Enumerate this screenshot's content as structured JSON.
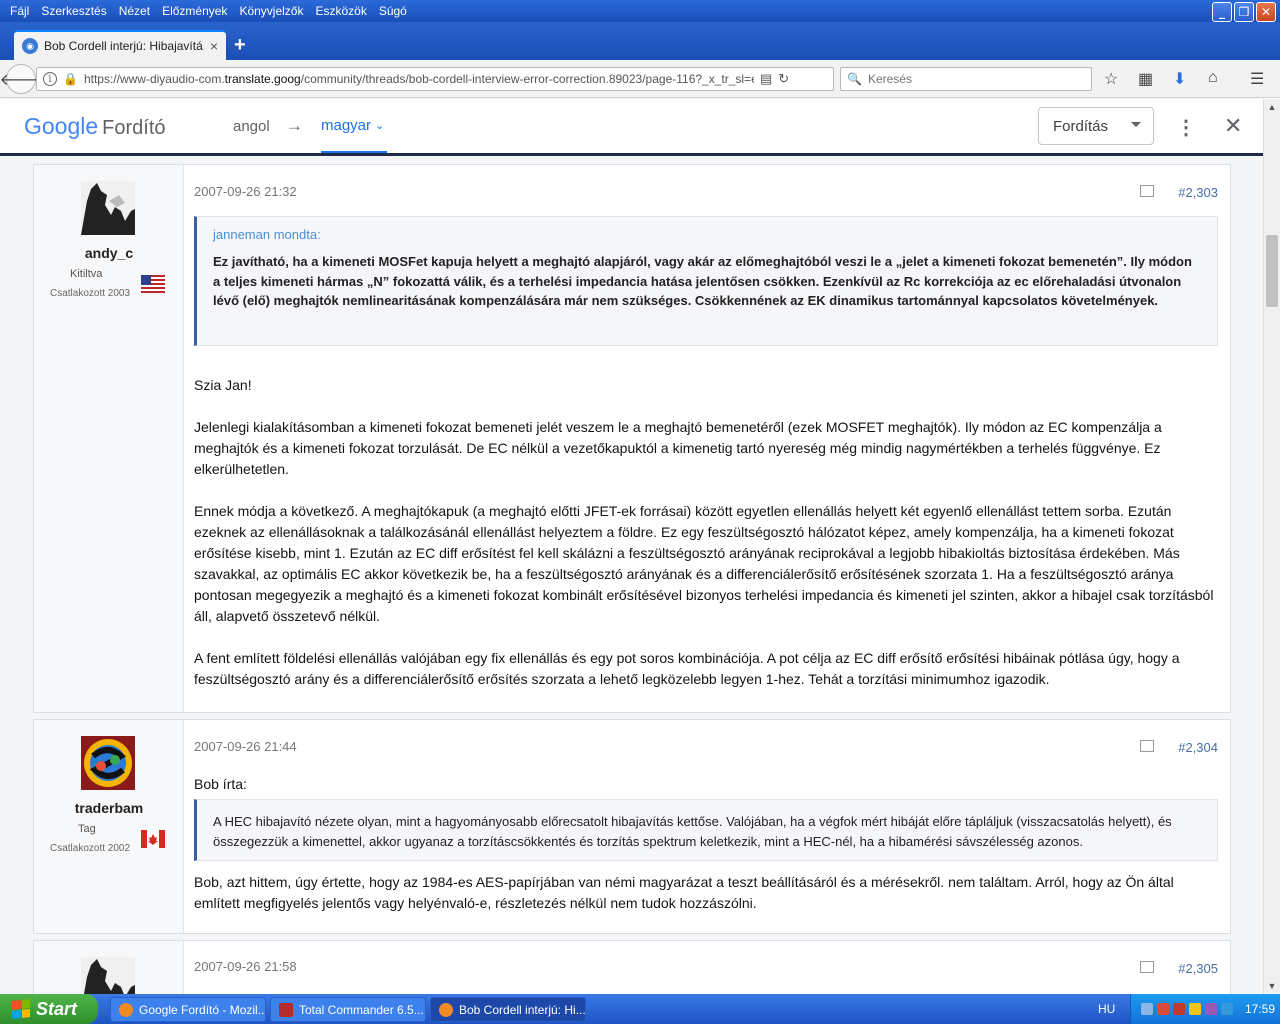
{
  "menubar": {
    "items": [
      "Fájl",
      "Szerkesztés",
      "Nézet",
      "Előzmények",
      "Könyvjelzők",
      "Eszközök",
      "Súgó"
    ]
  },
  "tab": {
    "title": "Bob Cordell interjú: Hibajavítá...",
    "close": "×",
    "new": "+"
  },
  "navbar": {
    "url_prefix": "https://www-diyaudio-com.",
    "url_host": "translate.goog",
    "url_rest": "/community/threads/bob-cordell-interview-error-correction.89023/page-116?_x_tr_sl=en&_x_tr_",
    "search_placeholder": "Keresés"
  },
  "translate_bar": {
    "logo_google": "Google",
    "logo_service": "Fordító",
    "source_lang": "angol",
    "arrow": "→",
    "target_lang": "magyar",
    "mode": "Fordítás"
  },
  "posts": [
    {
      "username": "andy_c",
      "user_title": "Kitiltva",
      "joined": "Csatlakozott 2003",
      "date": "2007-09-26 21:32",
      "number": "#2,303",
      "quote_author": "janneman mondta:",
      "quote_text": "Ez javítható, ha a kimeneti MOSFet kapuja helyett a meghajtó alapjáról, vagy akár az előmeghajtóból veszi le a „jelet a kimeneti fokozat bemenetén”. Ily módon a teljes kimeneti hármas „N” fokozattá válik, és a terhelési impedancia hatása jelentősen csökken. Ezenkívül az Rc korrekciója az ec előrehaladási útvonalon lévő (elő) meghajtók nemlinearitásának kompenzálására már nem szükséges. Csökkennének az EK dinamikus tartománnyal kapcsolatos követelmények.",
      "paragraphs": [
        "Szia Jan!",
        "Jelenlegi kialakításomban a kimeneti fokozat bemeneti jelét veszem le a meghajtó bemenetéről (ezek MOSFET meghajtók). Ily módon az EC kompenzálja a meghajtók és a kimeneti fokozat torzulását. De EC nélkül a vezetőkapuktól a kimenetig tartó nyereség még mindig nagymértékben a terhelés függvénye. Ez elkerülhetetlen.",
        "Ennek módja a következő. A meghajtókapuk (a meghajtó előtti JFET-ek forrásai) között egyetlen ellenállás helyett két egyenlő ellenállást tettem sorba. Ezután ezeknek az ellenállásoknak a találkozásánál ellenállást helyeztem a földre. Ez egy feszültségosztó hálózatot képez, amely kompenzálja, ha a kimeneti fokozat erősítése kisebb, mint 1. Ezután az EC diff erősítést fel kell skálázni a feszültségosztó arányának reciprokával a legjobb hibakioltás biztosítása érdekében. Más szavakkal, az optimális EC akkor következik be, ha a feszültségosztó arányának és a differenciálerősítő erősítésének szorzata 1. Ha a feszültségosztó aránya pontosan megegyezik a meghajtó és a kimeneti fokozat kombinált erősítésével bizonyos terhelési impedancia és kimeneti jel szinten, akkor a hibajel csak torzításból áll, alapvető összetevő nélkül.",
        "A fent említett földelési ellenállás valójában egy fix ellenállás és egy pot soros kombinációja. A pot célja az EC diff erősítő erősítési hibáinak pótlása úgy, hogy a feszültségosztó arány és a differenciálerősítő erősítés szorzata a lehető legközelebb legyen 1-hez. Tehát a torzítási minimumhoz igazodik."
      ]
    },
    {
      "username": "traderbam",
      "user_title": "Tag",
      "joined": "Csatlakozott 2002",
      "date": "2007-09-26 21:44",
      "number": "#2,304",
      "intro": "Bob írta:",
      "quote_text": "A HEC hibajavító nézete olyan, mint a hagyományosabb előrecsatolt hibajavítás kettőse. Valójában, ha a végfok mért hibáját előre tápláljuk (visszacsatolás helyett), és összegezzük a kimenettel, akkor ugyanaz a torzításcsökkentés és torzítás spektrum keletkezik, mint a HEC-nél, ha a hibamérési sávszélesség azonos.",
      "paragraphs": [
        "Bob, azt hittem, úgy értette, hogy az 1984-es AES-papírjában van némi magyarázat a teszt beállításáról és a mérésekről. nem találtam. Arról, hogy az Ön által említett megfigyelés jelentős vagy helyénvaló-e, részletezés nélkül nem tudok hozzászólni."
      ]
    },
    {
      "date": "2007-09-26 21:58",
      "number": "#2,305"
    }
  ],
  "taskbar": {
    "start": "Start",
    "tasks": [
      "Google Fordító - Mozil...",
      "Total Commander 6.5...",
      "Bob Cordell interjú: Hi..."
    ],
    "lang": "HU",
    "clock": "17:59"
  },
  "colors": {
    "link_blue": "#1a73e8",
    "quote_author": "#4a8fd2",
    "xp_blue": "#245edb",
    "start_green": "#3c9e38"
  }
}
